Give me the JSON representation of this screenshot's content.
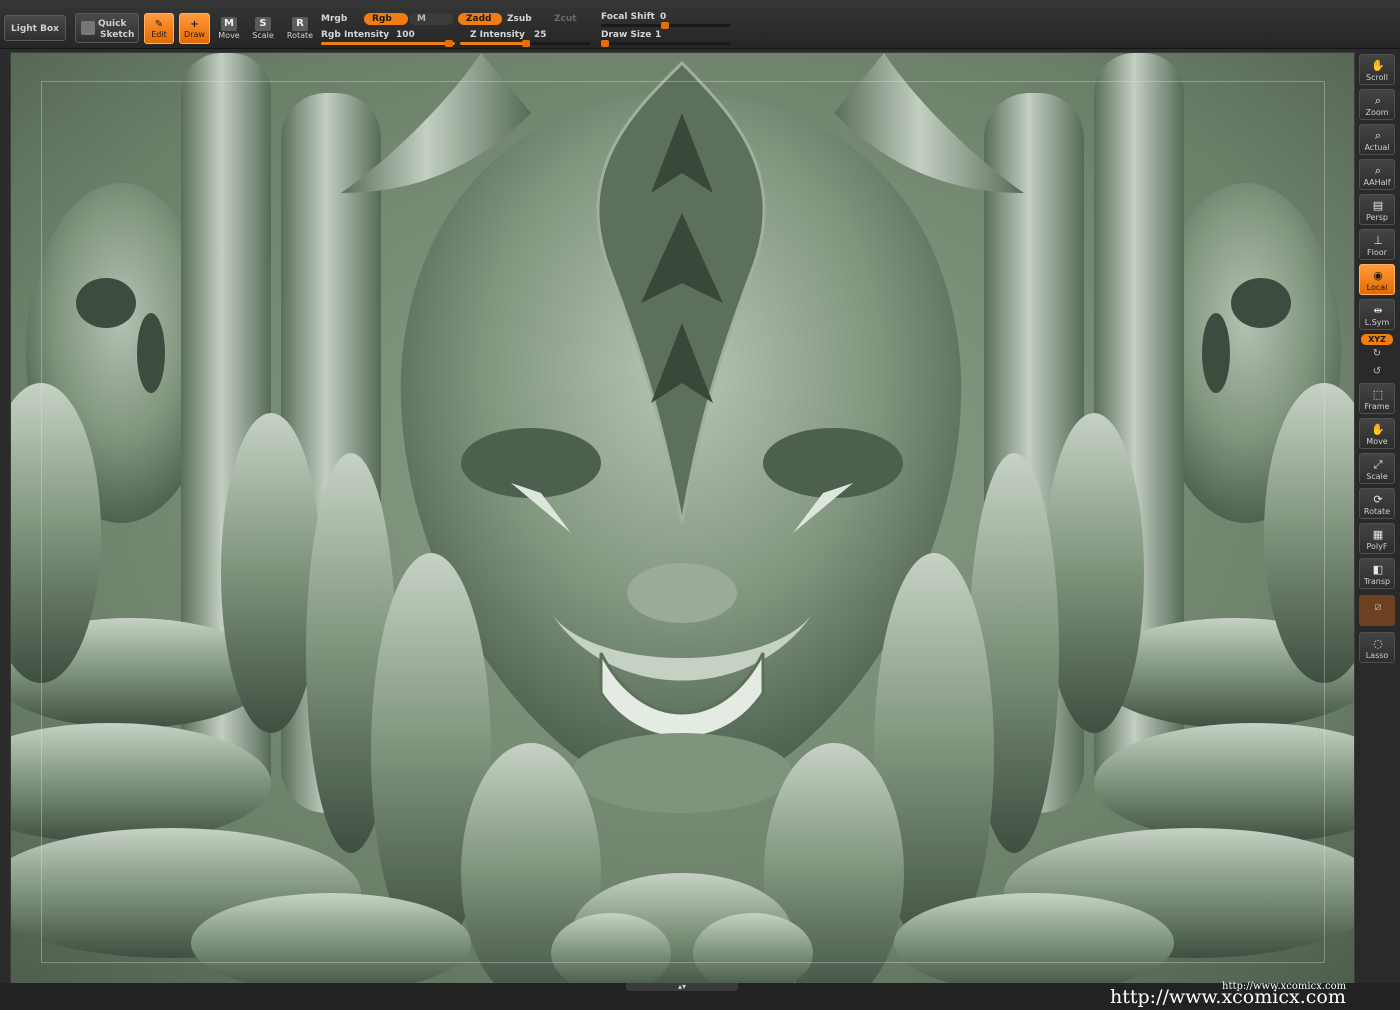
{
  "top_bar": {
    "light_box": "Light Box",
    "quick_sketch_line1": "Quick",
    "quick_sketch_line2": "Sketch",
    "tools": [
      {
        "label": "Edit",
        "icon": "edit-icon",
        "active": true
      },
      {
        "label": "Draw",
        "icon": "draw-icon",
        "active": true
      },
      {
        "label": "Move",
        "icon": "M",
        "active": false
      },
      {
        "label": "Scale",
        "icon": "S",
        "active": false
      },
      {
        "label": "Rotate",
        "icon": "R",
        "active": false
      }
    ],
    "mrgb": "Mrgb",
    "rgb": "Rgb",
    "m": "M",
    "rgb_intensity_label": "Rgb Intensity",
    "rgb_intensity_value": "100",
    "zadd": "Zadd",
    "zsub": "Zsub",
    "zcut": "Zcut",
    "z_intensity_label": "Z Intensity",
    "z_intensity_value": "25",
    "focal_shift_label": "Focal Shift",
    "focal_shift_value": "0",
    "draw_size_label": "Draw Size",
    "draw_size_value": "1"
  },
  "right_shelf": {
    "buttons": [
      {
        "label": "Scroll",
        "icon": "scroll-icon"
      },
      {
        "label": "Zoom",
        "icon": "zoom-icon"
      },
      {
        "label": "Actual",
        "icon": "actual-icon"
      },
      {
        "label": "AAHalf",
        "icon": "aahalf-icon"
      },
      {
        "label": "Persp",
        "icon": "persp-icon"
      },
      {
        "label": "Floor",
        "icon": "floor-icon"
      },
      {
        "label": "Local",
        "icon": "local-icon",
        "active": true
      },
      {
        "label": "L.Sym",
        "icon": "lsym-icon"
      },
      {
        "label": "Frame",
        "icon": "frame-icon"
      },
      {
        "label": "Move",
        "icon": "move-icon"
      },
      {
        "label": "Scale",
        "icon": "scale-icon"
      },
      {
        "label": "Rotate",
        "icon": "rotate-icon"
      },
      {
        "label": "PolyF",
        "icon": "polyf-icon"
      },
      {
        "label": "Transp",
        "icon": "transp-icon"
      },
      {
        "label": "",
        "icon": "ghost-icon",
        "dim": true
      },
      {
        "label": "Lasso",
        "icon": "lasso-icon"
      }
    ],
    "xyz": "XYZ"
  },
  "watermark": {
    "small": "http://www.xcomicx.com",
    "big": "http://www.xcomicx.com"
  },
  "colors": {
    "accent": "#f07c12",
    "panel": "#2b2b2b",
    "sculpt": "#7b9178"
  }
}
